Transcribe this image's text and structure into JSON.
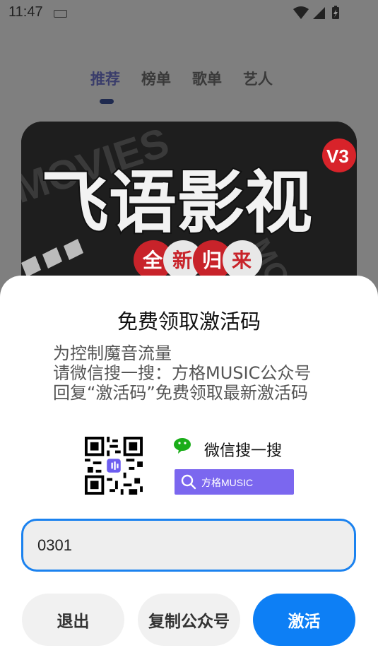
{
  "status_bar": {
    "time": "11:47"
  },
  "tabs": [
    {
      "label": "推荐"
    },
    {
      "label": "榜单"
    },
    {
      "label": "歌单"
    },
    {
      "label": "艺人"
    }
  ],
  "banner": {
    "headline": "飞语影视",
    "version_badge": "V3",
    "bg_word": "MOVIES",
    "tagline": [
      "全",
      "新",
      "归",
      "来"
    ]
  },
  "dialog": {
    "title": "免费领取激活码",
    "lines": [
      "为控制魔音流量",
      "请微信搜一搜：方格MUSIC公众号",
      "回复“激活码”免费领取最新激活码"
    ],
    "wechat_label": "微信搜一搜",
    "search_text": "方格MUSIC",
    "input_value": "0301",
    "buttons": {
      "exit": "退出",
      "copy": "复制公众号",
      "activate": "激活"
    }
  },
  "colors": {
    "primary": "#0d7ff5",
    "search_purple": "#7b67ef",
    "wechat_green": "#1aad19"
  }
}
